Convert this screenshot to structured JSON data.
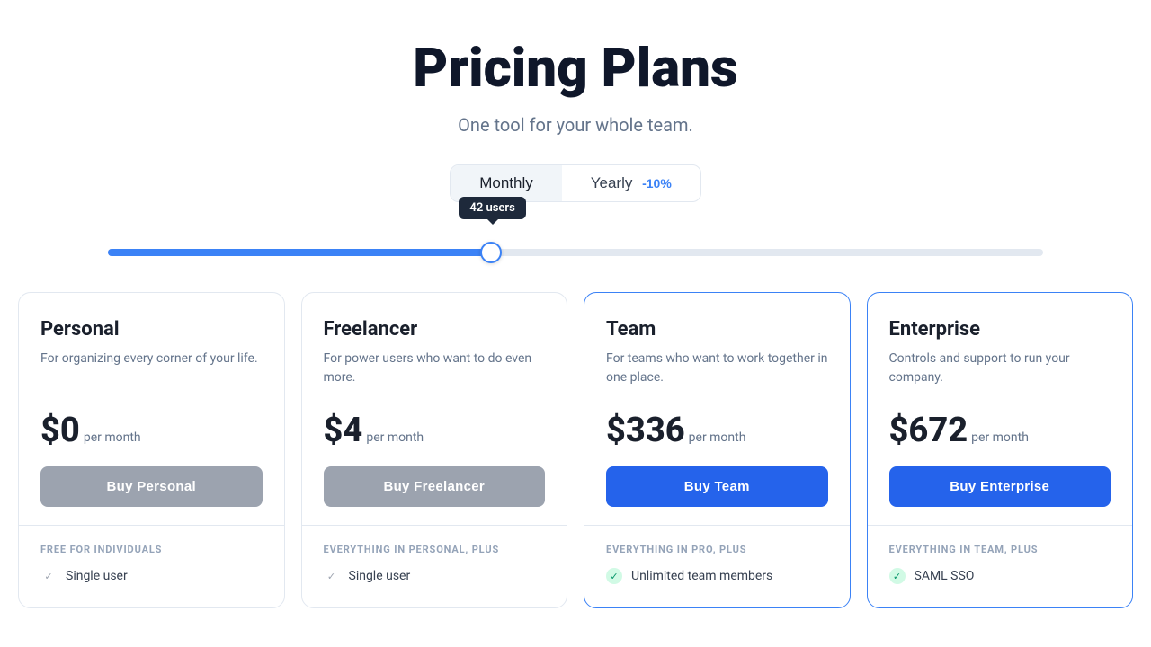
{
  "header": {
    "title": "Pricing Plans",
    "subtitle": "One tool for your whole team."
  },
  "billing": {
    "monthly_label": "Monthly",
    "yearly_label": "Yearly",
    "discount_label": "-10%",
    "active": "monthly"
  },
  "slider": {
    "tooltip": "42 users",
    "value": 42,
    "min": 1,
    "max": 100
  },
  "plans": [
    {
      "id": "personal",
      "name": "Personal",
      "desc": "For organizing every corner of your life.",
      "price": "$0",
      "period": "per month",
      "btn_label": "Buy Personal",
      "btn_style": "gray",
      "features_label": "FREE FOR INDIVIDUALS",
      "features": [
        {
          "text": "Single user",
          "style": "gray"
        }
      ]
    },
    {
      "id": "freelancer",
      "name": "Freelancer",
      "desc": "For power users who want to do even more.",
      "price": "$4",
      "period": "per month",
      "btn_label": "Buy Freelancer",
      "btn_style": "gray",
      "features_label": "EVERYTHING IN PERSONAL, PLUS",
      "features": [
        {
          "text": "Single user",
          "style": "gray"
        }
      ]
    },
    {
      "id": "team",
      "name": "Team",
      "desc": "For teams who want to work together in one place.",
      "price": "$336",
      "period": "per month",
      "btn_label": "Buy Team",
      "btn_style": "blue",
      "features_label": "EVERYTHING IN PRO, PLUS",
      "features": [
        {
          "text": "Unlimited team members",
          "style": "green"
        }
      ]
    },
    {
      "id": "enterprise",
      "name": "Enterprise",
      "desc": "Controls and support to run your company.",
      "price": "$672",
      "period": "per month",
      "btn_label": "Buy Enterprise",
      "btn_style": "blue",
      "features_label": "EVERYTHING IN TEAM, PLUS",
      "features": [
        {
          "text": "SAML SSO",
          "style": "green"
        }
      ]
    }
  ]
}
